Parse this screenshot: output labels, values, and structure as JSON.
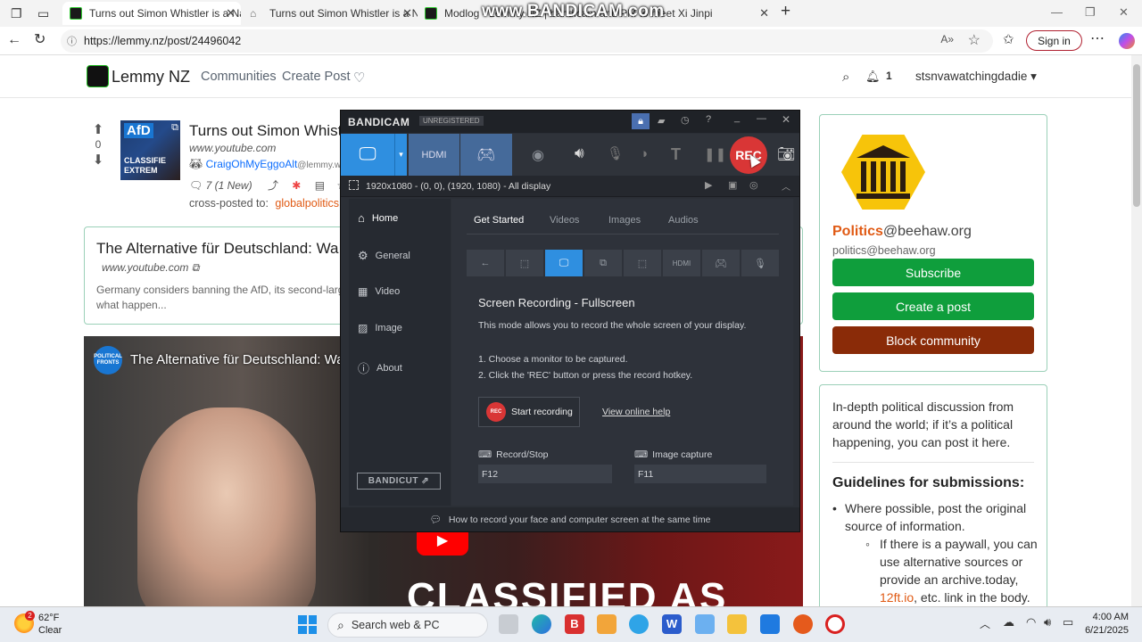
{
  "browser": {
    "tabs": [
      {
        "title": "Turns out Simon Whistler is a Naz",
        "active": true
      },
      {
        "title": "Turns out Simon Whistler is a Naz",
        "active": false
      },
      {
        "title": "Modlog - Lemmy NZ | bandicam and PM to meet Xi Jinpi",
        "active": false
      }
    ],
    "url": "https://lemmy.nz/post/24496042",
    "watermark": "www.BANDICAM.com",
    "sign_in_label": "Sign in"
  },
  "site": {
    "name": "Lemmy NZ",
    "nav": {
      "communities": "Communities",
      "create_post": "Create Post"
    },
    "notifications": "1",
    "username": "stsnvawatchingdadie"
  },
  "post": {
    "score": "0",
    "title": "Turns out Simon Whist",
    "domain": "www.youtube.com",
    "author": "CraigOhMyEggoAlt",
    "author_instance": "@lemmy.w",
    "comments": "7 (1 New)",
    "crosspost_label": "cross-posted to:",
    "crosspost_target": "globalpolitics@",
    "thumb_text": [
      "AfD",
      "CLASSIFIE",
      "EXTREM"
    ]
  },
  "embed": {
    "title": "The Alternative für Deutschland: Wa",
    "domain": "www.youtube.com",
    "description": "Germany considers banning the AfD, its second-large",
    "description2": "what happen..."
  },
  "video": {
    "channel": "POLITICAL FRONTS",
    "title": "The Alternative für Deutschland: Wa",
    "overlay_text": "CLASSIFIED AS"
  },
  "sidebar": {
    "community_name": "Politics",
    "community_instance": "@beehaw.org",
    "community_handle": "politics@beehaw.org",
    "subscribe": "Subscribe",
    "create_post": "Create a post",
    "block": "Block community",
    "description": "In-depth political discussion from around the world; if it’s a political happening, you can post it here.",
    "guidelines_title": "Guidelines for submissions:",
    "guideline1": "Where possible, post the original source of information.",
    "guideline2_a": "If there is a paywall, you can use alternative sources or provide an archive.today, ",
    "guideline2_link": "12ft.io",
    "guideline2_b": ", etc. link in the body.",
    "colors": {
      "subscribe": "#0f9e3c",
      "create": "#0f9e3c",
      "block": "#8a2b08"
    }
  },
  "bandicam": {
    "brand": "BANDICAM",
    "badge": "UNREGISTERED",
    "rec_label": "REC",
    "region": "1920x1080 - (0, 0), (1920, 1080) - All display",
    "menu": [
      "Home",
      "General",
      "Video",
      "Image",
      "About"
    ],
    "bandicut": "BANDICUT",
    "tabs": [
      "Get Started",
      "Videos",
      "Images",
      "Audios"
    ],
    "heading": "Screen Recording - Fullscreen",
    "desc": "This mode allows you to record the whole screen of your display.",
    "step1": "1. Choose a monitor to be captured.",
    "step2": "2. Click the 'REC' button or press the record hotkey.",
    "start_recording": "Start recording",
    "rec_small": "REC",
    "help": "View online help",
    "record_stop_label": "Record/Stop",
    "record_stop_key": "F12",
    "image_capture_label": "Image capture",
    "image_capture_key": "F11",
    "footer": "How to record your face and computer screen at the same time"
  },
  "taskbar": {
    "temp": "62°F",
    "weather": "Clear",
    "weather_badge": "2",
    "search": "Search web & PC",
    "time": "4:00 AM",
    "date": "6/21/2025"
  }
}
